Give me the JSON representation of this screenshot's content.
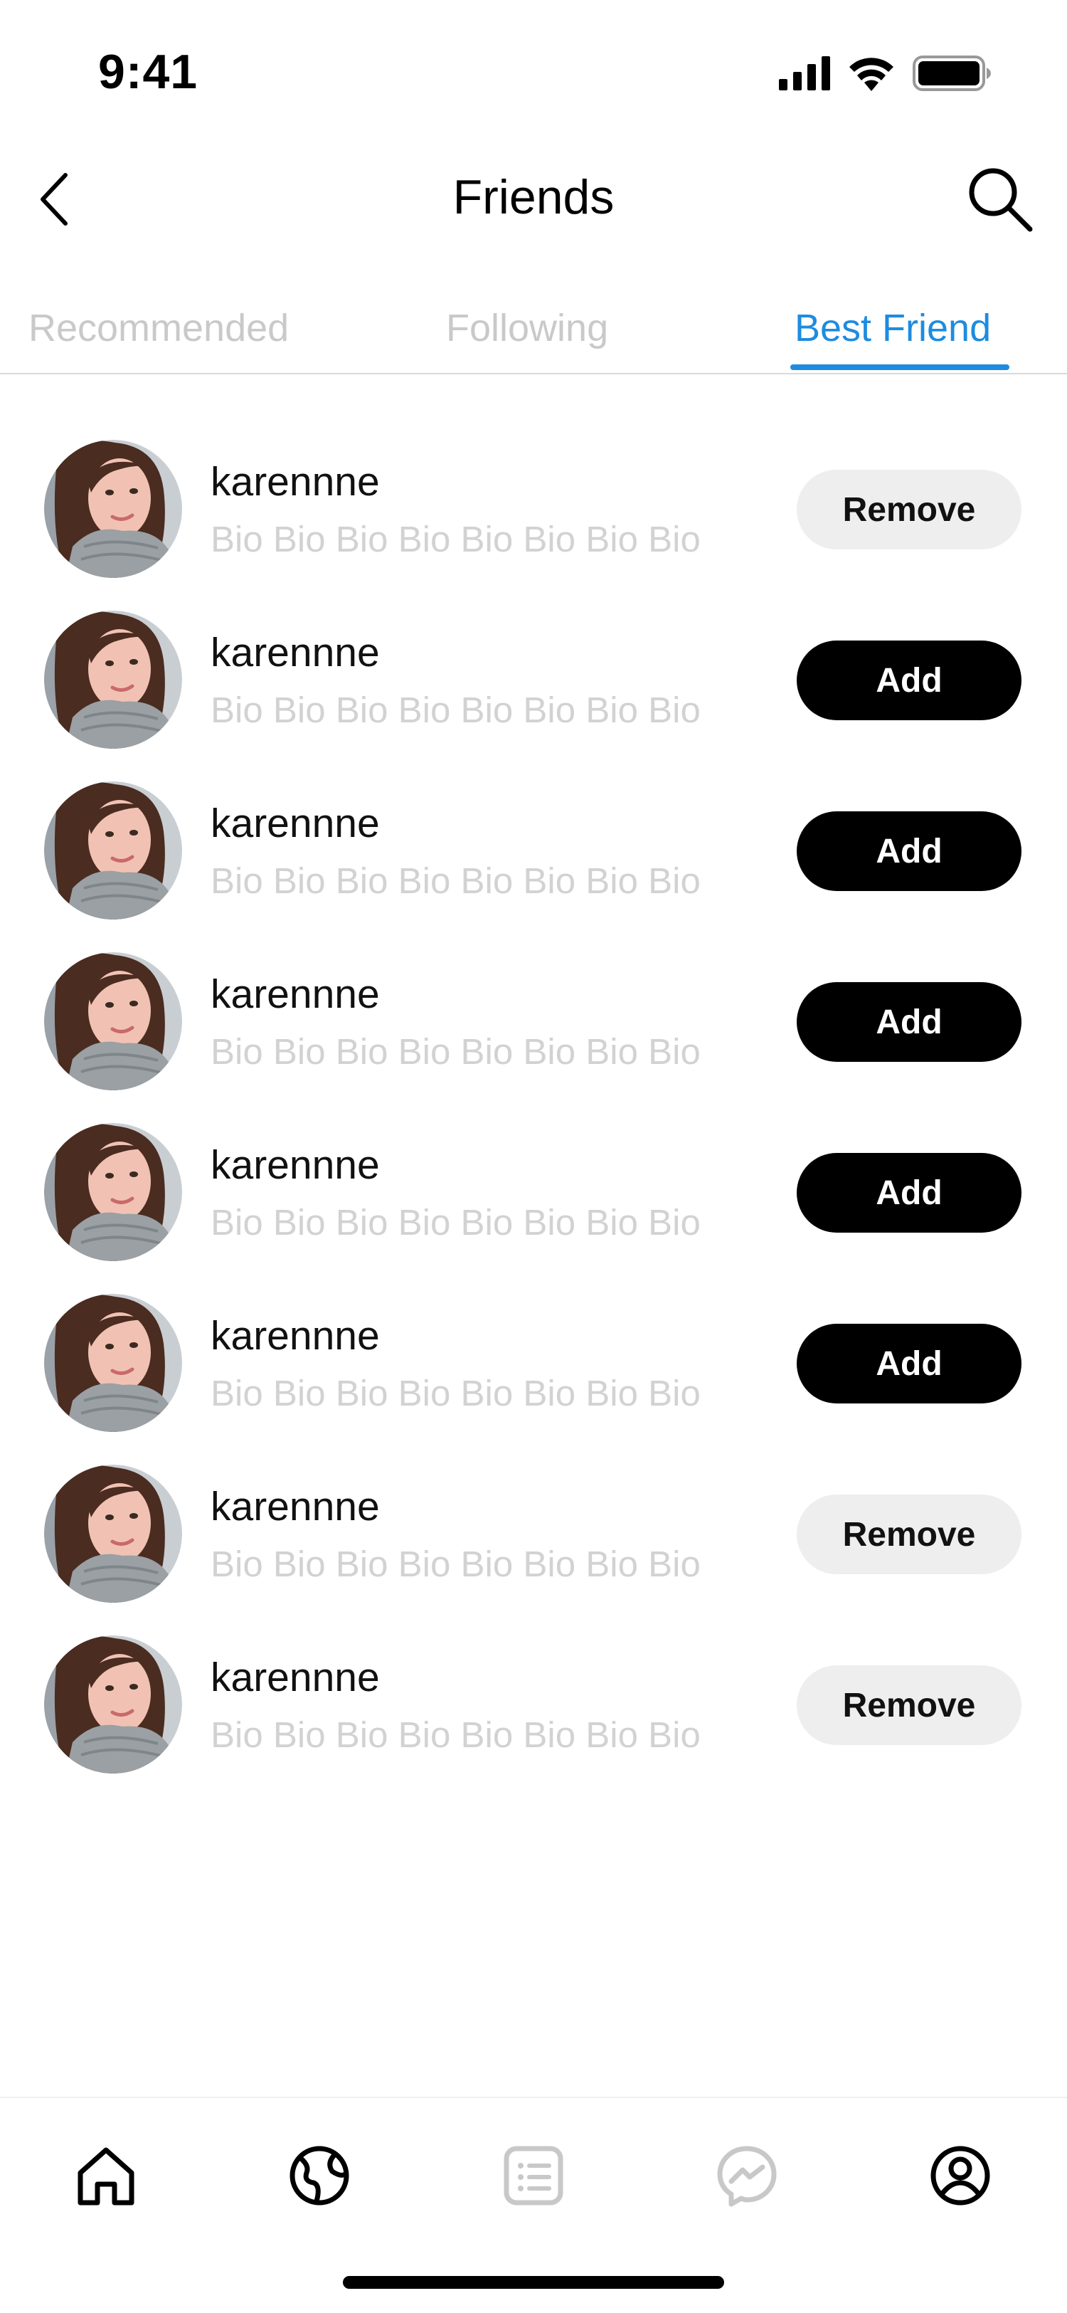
{
  "status_bar": {
    "time": "9:41"
  },
  "header": {
    "title": "Friends"
  },
  "tabs": [
    {
      "label": "Recommended",
      "active": false
    },
    {
      "label": "Following",
      "active": false
    },
    {
      "label": "Best Friend",
      "active": true
    }
  ],
  "friends": [
    {
      "username": "karennne",
      "bio": "Bio Bio Bio Bio Bio Bio Bio Bio",
      "action": "Remove"
    },
    {
      "username": "karennne",
      "bio": "Bio Bio Bio Bio Bio Bio Bio Bio",
      "action": "Add"
    },
    {
      "username": "karennne",
      "bio": "Bio Bio Bio Bio Bio Bio Bio Bio",
      "action": "Add"
    },
    {
      "username": "karennne",
      "bio": "Bio Bio Bio Bio Bio Bio Bio Bio",
      "action": "Add"
    },
    {
      "username": "karennne",
      "bio": "Bio Bio Bio Bio Bio Bio Bio Bio",
      "action": "Add"
    },
    {
      "username": "karennne",
      "bio": "Bio Bio Bio Bio Bio Bio Bio Bio",
      "action": "Add"
    },
    {
      "username": "karennne",
      "bio": "Bio Bio Bio Bio Bio Bio Bio Bio",
      "action": "Remove"
    },
    {
      "username": "karennne",
      "bio": "Bio Bio Bio Bio Bio Bio Bio Bio",
      "action": "Remove"
    }
  ],
  "bottom_nav": [
    {
      "icon": "home-icon",
      "active": true
    },
    {
      "icon": "globe-icon",
      "active": true
    },
    {
      "icon": "list-icon",
      "active": false
    },
    {
      "icon": "messenger-icon",
      "active": false
    },
    {
      "icon": "profile-icon",
      "active": true
    }
  ],
  "colors": {
    "accent": "#1d8ce0",
    "inactive_tab": "#c9c9c9",
    "bio_text": "#d2d2d2",
    "add_button": "#000000",
    "remove_button": "#eeeeee"
  }
}
